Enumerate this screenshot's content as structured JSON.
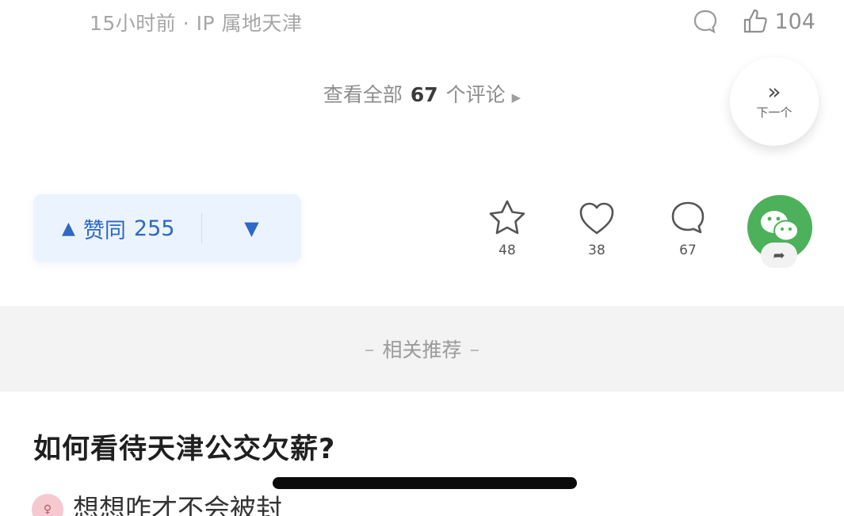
{
  "comment": {
    "meta": "15小时前 · IP 属地天津",
    "like_count": "104"
  },
  "comments_link": {
    "prefix": "查看全部",
    "count": "67",
    "suffix": "个评论"
  },
  "next_button": {
    "label": "下一个"
  },
  "vote": {
    "agree_label": "赞同",
    "agree_count": "255"
  },
  "actions": {
    "favorite_count": "48",
    "like_count": "38",
    "comment_count": "67"
  },
  "related": {
    "title": "相关推荐"
  },
  "related_question": {
    "title": "如何看待天津公交欠薪?",
    "answer_preview": "想想咋才不会被封"
  },
  "colors": {
    "accent_blue": "#2c68c6",
    "wechat_green": "#4cb15a",
    "section_bg": "#f3f3f3"
  }
}
